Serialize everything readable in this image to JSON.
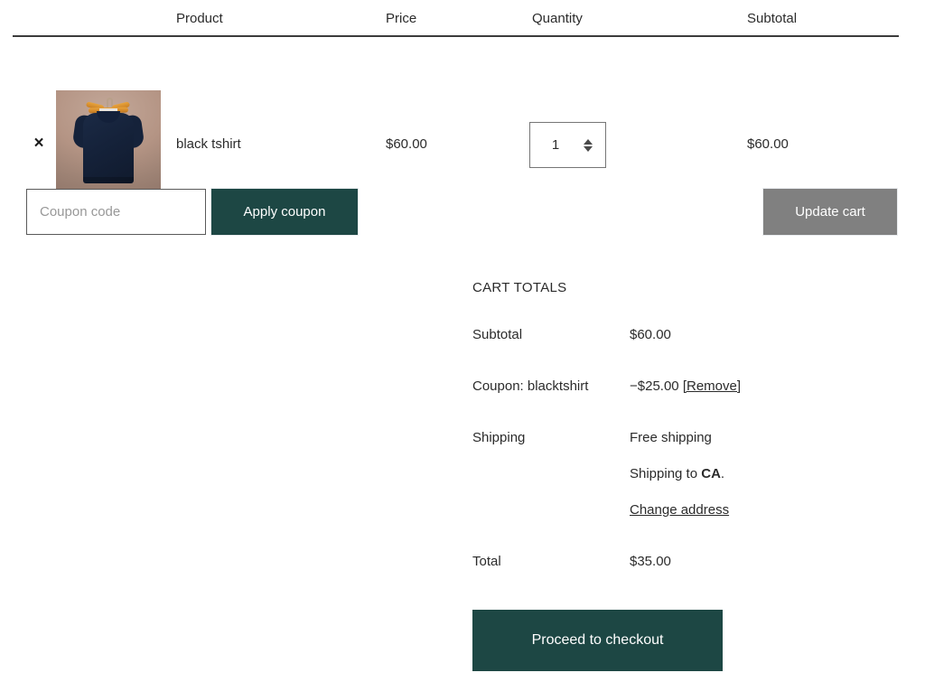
{
  "table": {
    "headers": {
      "product": "Product",
      "price": "Price",
      "quantity": "Quantity",
      "subtotal": "Subtotal"
    },
    "rows": [
      {
        "remove_icon": "×",
        "name": "black tshirt",
        "price": "$60.00",
        "quantity": "1",
        "subtotal": "$60.00",
        "thumbnail_alt": "black tshirt on hanger"
      }
    ]
  },
  "actions": {
    "coupon_placeholder": "Coupon code",
    "coupon_value": "",
    "apply_coupon_label": "Apply coupon",
    "update_cart_label": "Update cart"
  },
  "totals": {
    "title": "CART TOTALS",
    "subtotal_label": "Subtotal",
    "subtotal_value": "$60.00",
    "coupon_label": "Coupon: blacktshirt",
    "coupon_value": "−$25.00",
    "coupon_remove_label": "[Remove]",
    "shipping_label": "Shipping",
    "shipping_method": "Free shipping",
    "shipping_to_prefix": "Shipping to ",
    "shipping_to_state": "CA",
    "shipping_to_suffix": ".",
    "change_address_label": "Change address",
    "total_label": "Total",
    "total_value": "$35.00"
  },
  "checkout": {
    "label": "Proceed to checkout"
  },
  "colors": {
    "accent_teal": "#1d4744",
    "disabled_gray": "#808080",
    "text": "#2b2b2b",
    "border_dark": "#3c3c3c",
    "placeholder": "#989898"
  }
}
